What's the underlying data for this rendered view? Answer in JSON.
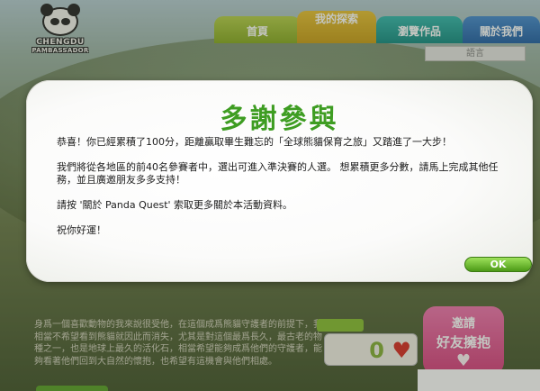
{
  "logo": {
    "line1": "CHENGDU",
    "line2": "PAMBASSADOR"
  },
  "nav": {
    "tabs": [
      {
        "label": "首頁"
      },
      {
        "label": "我的探索"
      },
      {
        "label": "瀏覽作品"
      },
      {
        "label": "關於我們"
      }
    ]
  },
  "language": {
    "label": "語言"
  },
  "background": {
    "text": "身爲一個喜歡動物的我來說很受他，在這個成爲熊貓守護者的前提下，我相當不希望看到熊貓就因此而消失，尤其是對這個最爲長久，最古老的物種之一，也是地球上最久的活化石，相當希望能夠成爲他們的守護者，能夠看著他們回到大自然的懷抱，也希望有這機會與他們相處。",
    "score": "0",
    "invite_line1": "邀請",
    "invite_line2": "好友擁抱"
  },
  "dialog": {
    "title": "多謝參與",
    "paragraphs": [
      "恭喜！你已經累積了100分，距離贏取畢生難忘的「全球熊貓保育之旅」又踏進了一大步！",
      "我們將從各地區的前40名參賽者中，選出可進入準決賽的人選。 想累積更多分數，請馬上完成其他任務，並且廣邀朋友多多支持！",
      "請按 '關於 Panda Quest' 索取更多關於本活動資料。",
      "祝你好運！"
    ],
    "ok_label": "OK"
  },
  "colors": {
    "title_green": "#3e9d22",
    "ok_button": "#5ca81f",
    "heart": "#d8342c"
  }
}
